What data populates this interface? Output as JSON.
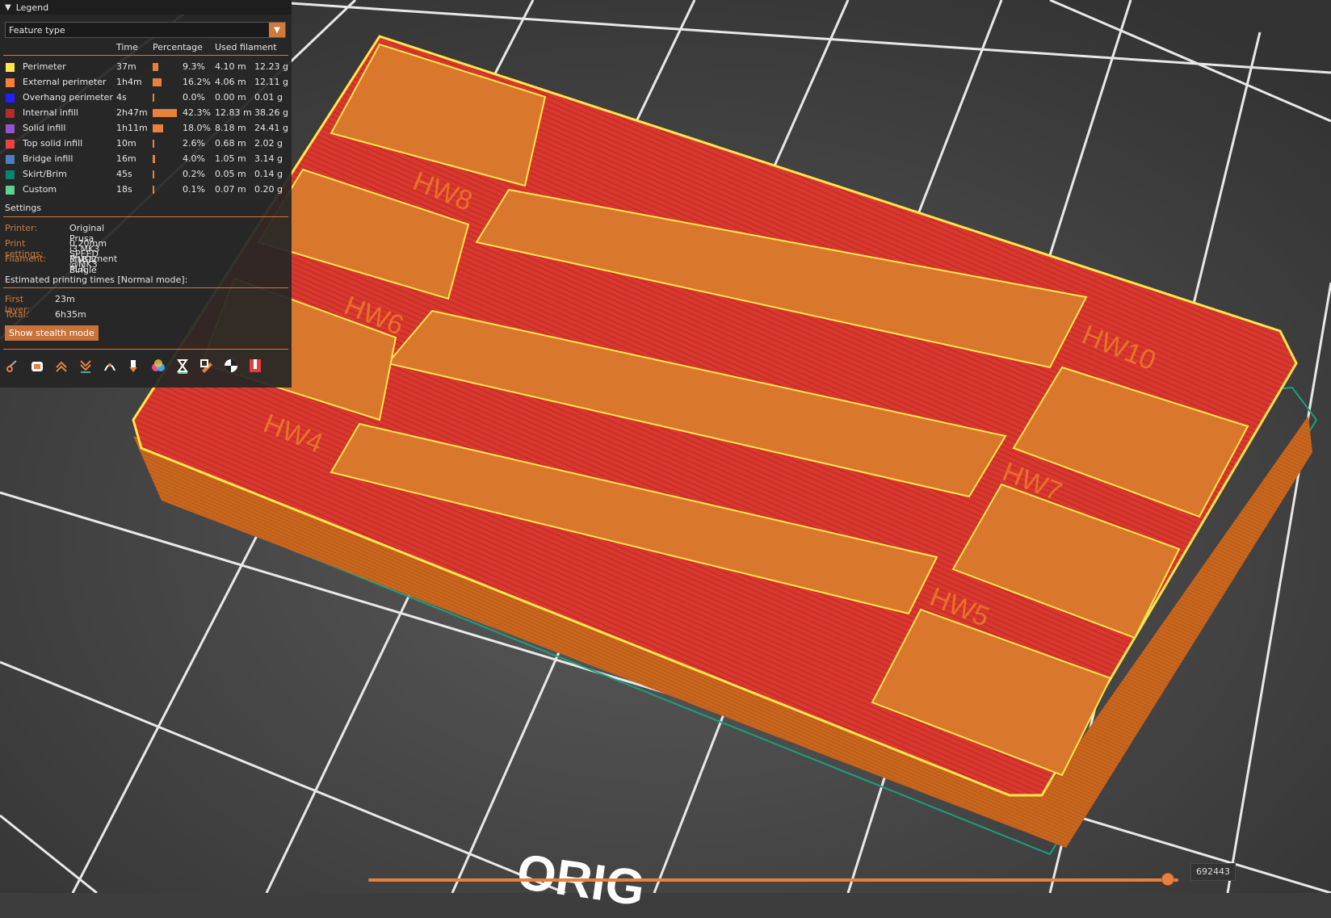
{
  "legend": {
    "title": "Legend",
    "view_type": "Feature type",
    "columns": {
      "time": "Time",
      "percentage": "Percentage",
      "used_filament": "Used filament"
    },
    "features": [
      {
        "name": "Perimeter",
        "color": "#ffe64d",
        "time": "37m",
        "pct": "9.3%",
        "pct_value": 9.3,
        "length": "4.10 m",
        "weight": "12.23 g"
      },
      {
        "name": "External perimeter",
        "color": "#ff7d38",
        "time": "1h4m",
        "pct": "16.2%",
        "pct_value": 16.2,
        "length": "4.06 m",
        "weight": "12.11 g"
      },
      {
        "name": "Overhang perimeter",
        "color": "#1f1fff",
        "time": "4s",
        "pct": "0.0%",
        "pct_value": 0.0,
        "length": "0.00 m",
        "weight": "0.01 g"
      },
      {
        "name": "Internal infill",
        "color": "#b03029",
        "time": "2h47m",
        "pct": "42.3%",
        "pct_value": 42.3,
        "length": "12.83 m",
        "weight": "38.26 g"
      },
      {
        "name": "Solid infill",
        "color": "#9654cc",
        "time": "1h11m",
        "pct": "18.0%",
        "pct_value": 18.0,
        "length": "8.18 m",
        "weight": "24.41 g"
      },
      {
        "name": "Top solid infill",
        "color": "#f04040",
        "time": "10m",
        "pct": "2.6%",
        "pct_value": 2.6,
        "length": "0.68 m",
        "weight": "2.02 g"
      },
      {
        "name": "Bridge infill",
        "color": "#4d80ba",
        "time": "16m",
        "pct": "4.0%",
        "pct_value": 4.0,
        "length": "1.05 m",
        "weight": "3.14 g"
      },
      {
        "name": "Skirt/Brim",
        "color": "#00876e",
        "time": "45s",
        "pct": "0.2%",
        "pct_value": 0.2,
        "length": "0.05 m",
        "weight": "0.14 g"
      },
      {
        "name": "Custom",
        "color": "#5ed194",
        "time": "18s",
        "pct": "0.1%",
        "pct_value": 0.1,
        "length": "0.07 m",
        "weight": "0.20 g"
      }
    ],
    "settings_title": "Settings",
    "settings": [
      {
        "key": "Printer:",
        "value": "Original Prusa i3 MK3 MMU2 Single"
      },
      {
        "key": "Print settings:",
        "value": "0.20mm SPEED @MK3"
      },
      {
        "key": "Filament:",
        "value": "Prusament PLA"
      }
    ],
    "estimates_title": "Estimated printing times [Normal mode]:",
    "estimates": [
      {
        "key": "First layer:",
        "value": "23m"
      },
      {
        "key": "Total:",
        "value": "6h35m"
      }
    ],
    "stealth_button": "Show stealth mode",
    "toolbar_icons": [
      "travel-icon",
      "wipe-icon",
      "retractions-icon",
      "deretractions-icon",
      "seams-icon",
      "tool-changes-icon",
      "color-changes-icon",
      "pause-prints-icon",
      "custom-gcode-icon",
      "center-of-gravity-icon",
      "shells-icon"
    ]
  },
  "model_labels": [
    "HW8",
    "HW10",
    "HW6",
    "HW4",
    "HW7",
    "HW5"
  ],
  "bed_logo": "ORIG",
  "slider": {
    "value": "692443",
    "position": 0.987
  }
}
